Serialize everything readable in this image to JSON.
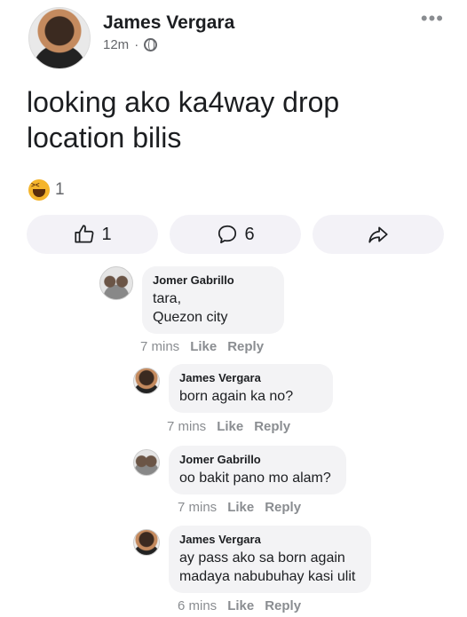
{
  "post": {
    "author": "James Vergara",
    "time": "12m",
    "separator": "·",
    "text": "looking ako ka4way drop location bilis",
    "reaction_count": "1",
    "like_count": "1",
    "comment_count": "6"
  },
  "comments": [
    {
      "name": "Jomer Gabrillo",
      "text": "tara,\nQuezon city",
      "time": "7 mins",
      "like": "Like",
      "reply": "Reply"
    },
    {
      "name": "James Vergara",
      "text": "born again ka no?",
      "time": "7 mins",
      "like": "Like",
      "reply": "Reply"
    },
    {
      "name": "Jomer Gabrillo",
      "text": "oo bakit pano mo alam?",
      "time": "7 mins",
      "like": "Like",
      "reply": "Reply"
    },
    {
      "name": "James Vergara",
      "text": "ay pass ako sa born again\nmadaya nabubuhay kasi ulit",
      "time": "6 mins",
      "like": "Like",
      "reply": "Reply"
    }
  ],
  "icons": {
    "more": "more-icon",
    "globe": "globe-icon",
    "reaction": "haha-icon",
    "like": "thumbs-up-icon",
    "comment": "comment-icon",
    "share": "share-icon"
  }
}
